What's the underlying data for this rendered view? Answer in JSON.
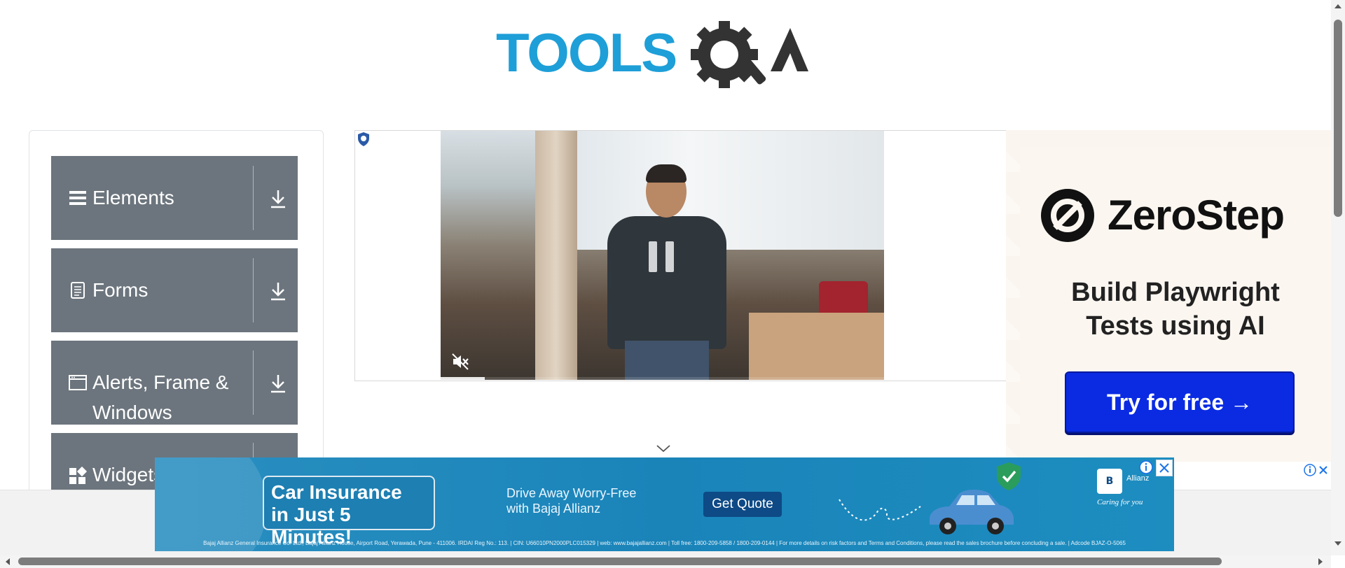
{
  "logo": {
    "text": "TOOLSQA",
    "colors": {
      "tools": "#1e9fd8",
      "qa": "#333333"
    }
  },
  "sidebar": {
    "groups": [
      {
        "label": "Elements",
        "icon": "hamburger-icon"
      },
      {
        "label": "Forms",
        "icon": "document-icon"
      },
      {
        "label": "Alerts, Frame & Windows",
        "icon": "window-icon"
      },
      {
        "label": "Widgets",
        "icon": "widgets-icon"
      }
    ]
  },
  "video_ad": {
    "progress": 0.1
  },
  "zerostep_ad": {
    "brand": "ZeroStep",
    "headline_line1": "Build Playwright",
    "headline_line2": "Tests using AI",
    "cta": "Try for free →"
  },
  "bottom_ad": {
    "headline_line1": "Car Insurance",
    "headline_line2": "in Just 5 Minutes!",
    "tagline_line1": "Drive Away Worry-Free",
    "tagline_line2": "with Bajaj Allianz",
    "cta": "Get Quote",
    "brand_name": "Allianz",
    "brand_mark": "B",
    "brand_tagline": "Caring for you",
    "disclaimer": "Bajaj Allianz General Insurance Co. Ltd., Bajaj Allianz House, Airport Road, Yerawada, Pune - 411006. IRDAI Reg No.: 113. | CIN: U66010PN2000PLC015329 | web: www.bajajallianz.com | Toll free: 1800-209-5858 / 1800-209-0144 | For more details on risk factors and Terms and Conditions, please read the sales brochure before concluding a sale. | Adcode BJAZ-O-5065"
  },
  "colors": {
    "menu_bg": "#6c757d",
    "accent_blue": "#0a2be2",
    "banner_blue": "#1d8dc0"
  }
}
